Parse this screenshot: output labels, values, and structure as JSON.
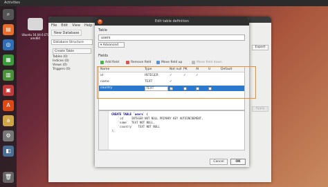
{
  "topbar": {
    "app": "Activities"
  },
  "desktop": {
    "icon_label": "Ubuntu 16.04.6 LTS amd64"
  },
  "main_window": {
    "title": "DB Browser for SQLite",
    "menu": [
      "File",
      "Edit",
      "View",
      "Help"
    ],
    "toolbar": {
      "new_db": "New Database"
    },
    "tab": "Database Structure",
    "create_table": "Create Table",
    "tree": [
      "Tables (0)",
      "Indices (0)",
      "Views (0)",
      "Triggers (0)"
    ],
    "export": "Export",
    "apply": "Apply"
  },
  "dialog": {
    "title": "Edit table definition",
    "table_section": "Table",
    "table_name": "users",
    "advanced": "Advanced",
    "fields_section": "Fields",
    "add_field": "Add field",
    "remove_field": "Remove field",
    "move_up": "Move field up",
    "move_down": "Move field down",
    "columns": [
      "Name",
      "Type",
      "Not null",
      "PK",
      "AI",
      "U",
      "Default"
    ],
    "rows": [
      {
        "name": "id",
        "type": "INTEGER",
        "not_null": "✓",
        "pk": "✓",
        "ai": "✓",
        "u": "",
        "selected": false
      },
      {
        "name": "name",
        "type": "TEXT",
        "not_null": "✓",
        "pk": "",
        "ai": "",
        "u": "",
        "selected": false
      },
      {
        "name": "country",
        "type": "TEXT",
        "not_null": "✓",
        "pk": "",
        "ai": "",
        "u": "",
        "selected": true
      }
    ],
    "sql": [
      "CREATE TABLE `users` (",
      "    `id`    INTEGER NOT NULL PRIMARY KEY AUTOINCREMENT,",
      "    `name`  TEXT NOT NULL,",
      "    `country`   TEXT NOT NULL",
      ");"
    ],
    "cancel": "Cancel",
    "ok": "OK"
  },
  "colors": {
    "accent": "#2a79cf",
    "highlight": "#f28a2b",
    "close": "#e95420"
  }
}
